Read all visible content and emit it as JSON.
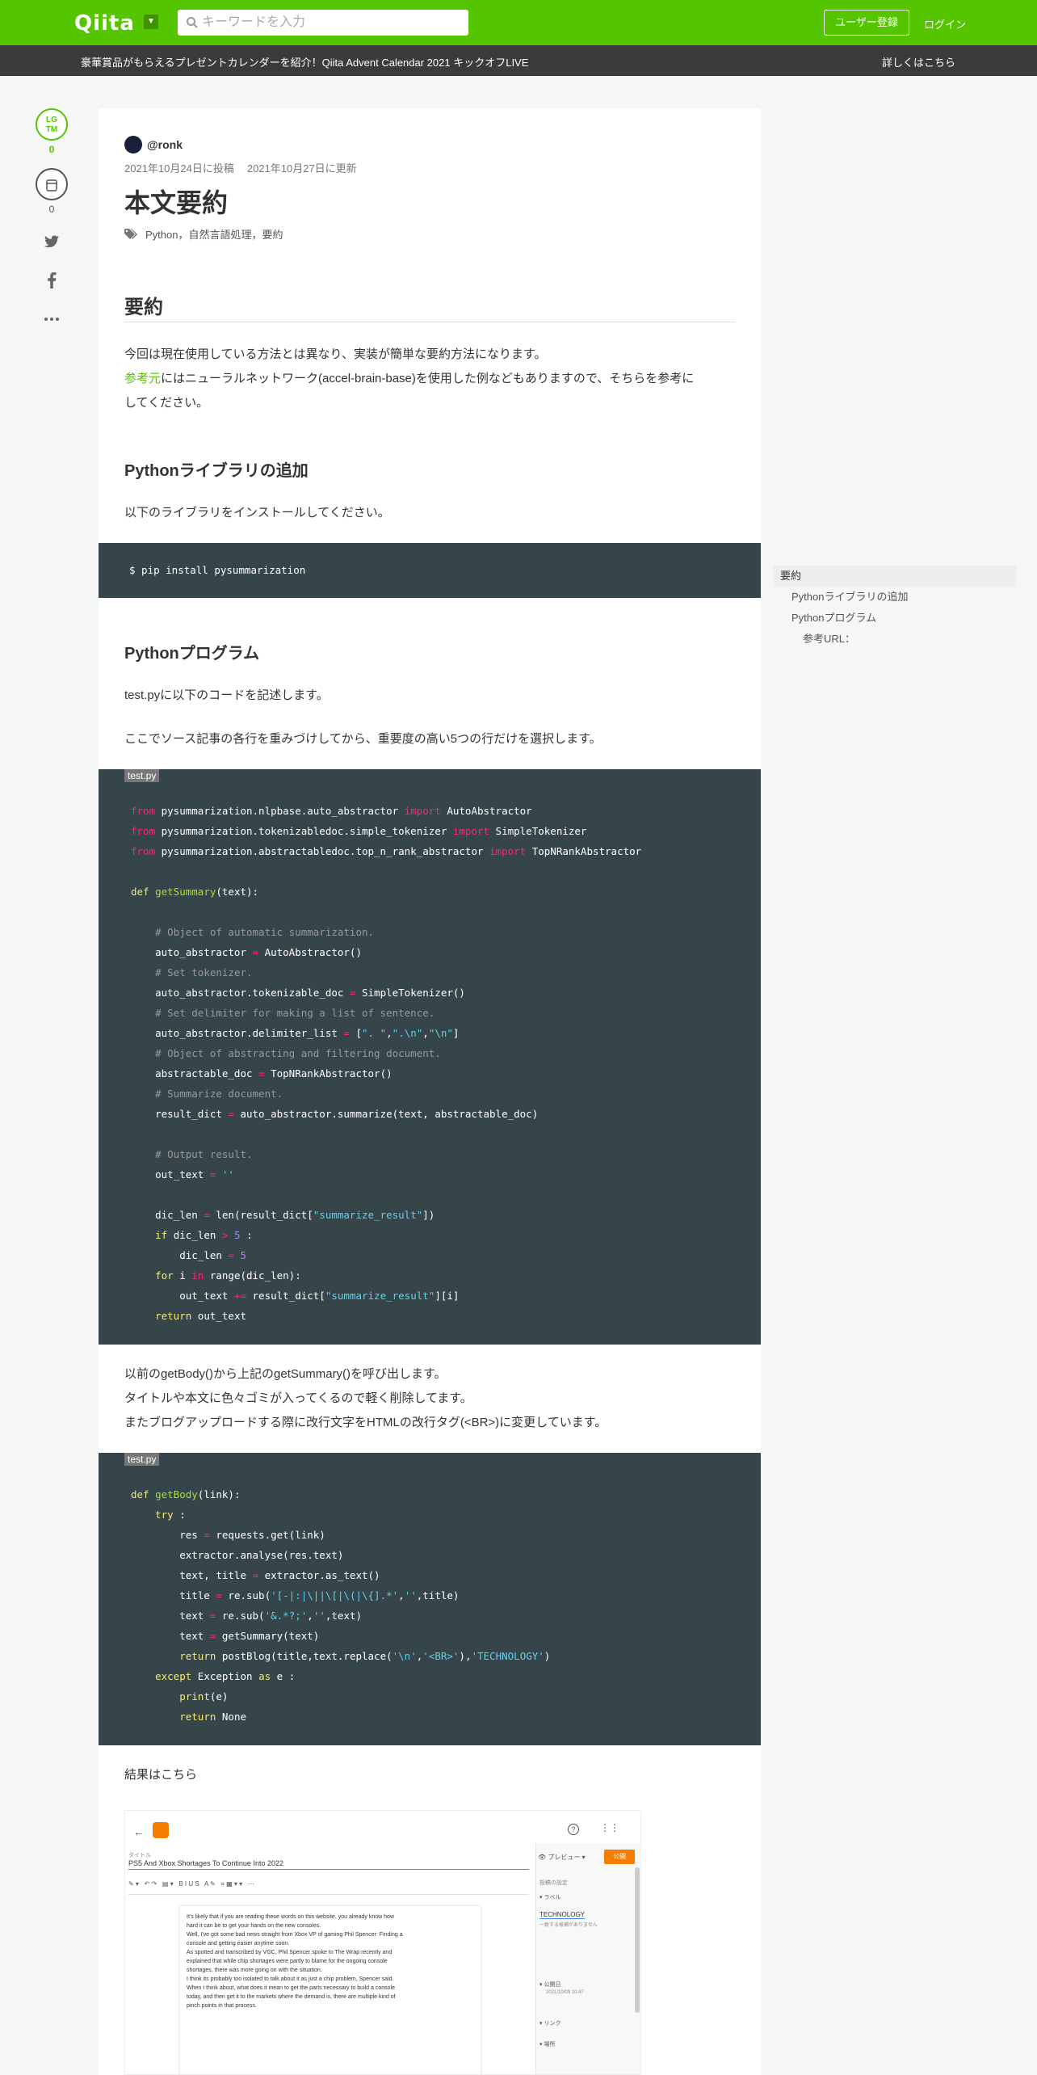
{
  "header": {
    "logo": "Qiita",
    "search_placeholder": "キーワードを入力",
    "signup": "ユーザー登録",
    "login": "ログイン",
    "accent": "#55c500"
  },
  "announce": {
    "text": "豪華賞品がもらえるプレゼントカレンダーを紹介！Qiita Advent Calendar 2021 キックオフLIVE",
    "link": "詳しくはこちら"
  },
  "rail": {
    "lgtm_label_1": "LG",
    "lgtm_label_2": "TM",
    "lgtm_count": "0",
    "stock_count": "0"
  },
  "article": {
    "author": "@ronk",
    "posted": "2021年10月24日に投稿",
    "updated": "2021年10月27日に更新",
    "title": "本文要約",
    "tags": "Python，自然言語処理，要約",
    "h_summary": "要約",
    "p1": "今回は現在使用している方法とは異なり、実装が簡単な要約方法になります。",
    "p2_link": "参考元",
    "p2_rest": "にはニューラルネットワーク(accel-brain-base)を使用した例などもありますので、そちらを参考に",
    "p2_cont": "してください。",
    "h_lib": "Pythonライブラリの追加",
    "p_lib": "以下のライブラリをインストールしてください。",
    "code_install": "$ pip install pysummarization",
    "h_prog": "Pythonプログラム",
    "p_prog1": "test.pyに以下のコードを記述します。",
    "p_prog2": "ここでソース記事の各行を重みづけしてから、重要度の高い5つの行だけを選択します。",
    "code_file": "test.py",
    "p_after1": "以前のgetBody()から上記のgetSummary()を呼び出します。",
    "p_after2": "タイトルや本文に色々ゴミが入ってくるので軽く削除してます。",
    "p_after3": "またブログアップロードする際に改行文字をHTMLの改行タグ(<BR>)に変更しています。",
    "code_file2": "test.py",
    "p_result": "結果はこちら"
  },
  "screenshot": {
    "post_title": "PS5 And Xbox Shortages To Continue Into 2022",
    "title_label": "タイトル",
    "preview": "プレビュー",
    "publish": "公開",
    "settings": "投稿の設定",
    "label": "ラベル",
    "label_value": "TECHNOLOGY",
    "label_note": "一致する候補がありません",
    "published_on": "公開日",
    "published_date": "2021/10/09 10:47",
    "link": "リンク",
    "location": "場所",
    "body_1": "It's likely that if you are reading these words on this website, you already know how",
    "body_2": "hard it can be to get your hands on the new consoles.",
    "body_3": "Well, I've got some bad news straight from Xbox VP of gaming Phil Spencer: Finding a",
    "body_4": "console and getting easier anytime soon.",
    "body_5": "As spotted and transcribed by VGC, Phil Spencer spoke to The Wrap recently and",
    "body_6": "explained that while chip shortages were partly to blame for the ongoing console",
    "body_7": "shortages, there was more going on with the situation.",
    "body_8": "I think its probably too isolated to talk about it as just a chip problem, Spencer said.",
    "body_9": "When I think about, what does it mean to get the parts necessary to build a console",
    "body_10": "today, and then get it to the markets where the demand is, there are multiple kind of",
    "body_11": "pinch points in that process."
  },
  "toc": {
    "items": [
      "要約",
      "Pythonライブラリの追加",
      "Pythonプログラム",
      "参考URL："
    ]
  }
}
